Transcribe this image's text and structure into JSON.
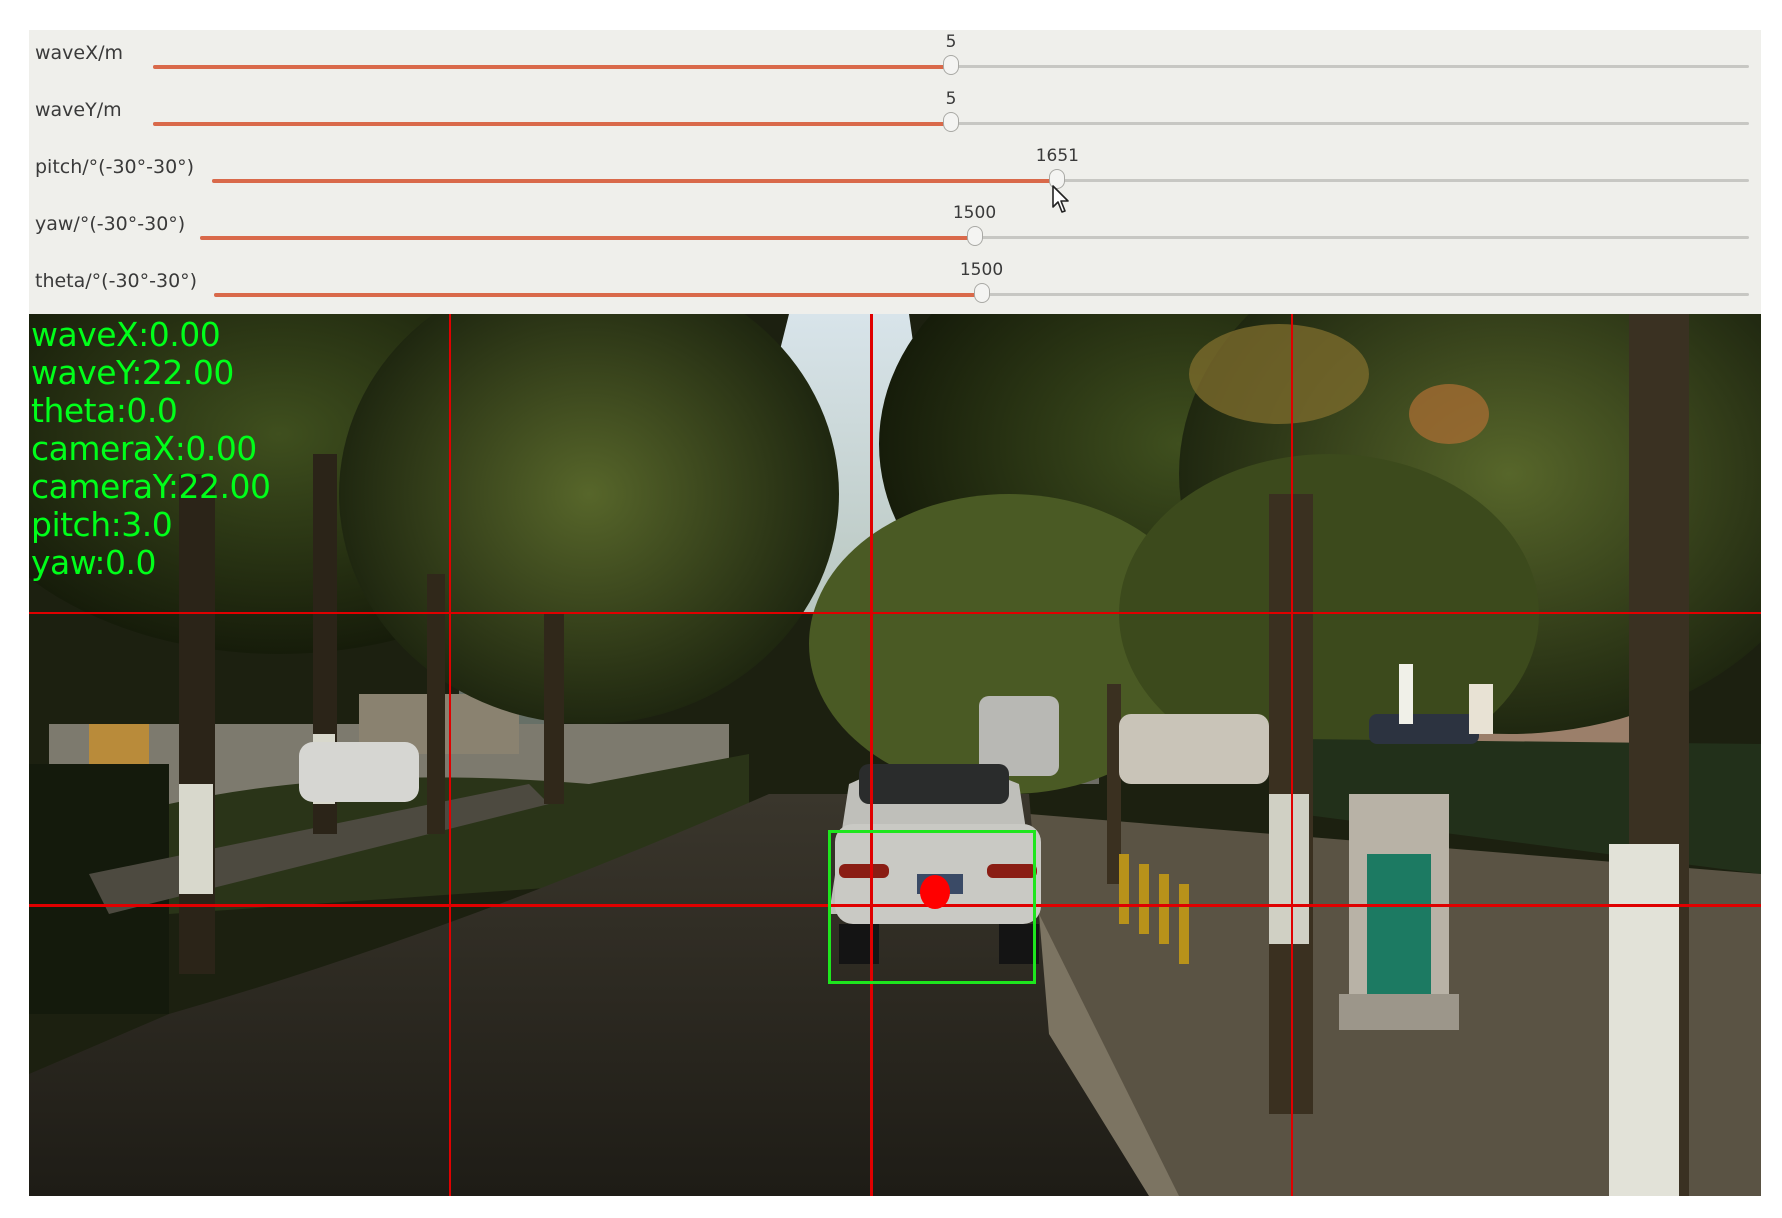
{
  "sliders": [
    {
      "label": "waveX/m",
      "value": "5",
      "fraction": 0.5
    },
    {
      "label": "waveY/m",
      "value": "5",
      "fraction": 0.5
    },
    {
      "label": "pitch/°(-30°-30°)",
      "value": "1651",
      "fraction": 0.55
    },
    {
      "label": "yaw/°(-30°-30°)",
      "value": "1500",
      "fraction": 0.5
    },
    {
      "label": "theta/°(-30°-30°)",
      "value": "1500",
      "fraction": 0.5
    }
  ],
  "overlay": {
    "lines": [
      "waveX:0.00",
      "waveY:22.00",
      "theta:0.0",
      "cameraX:0.00",
      "cameraY:22.00",
      "pitch:3.0",
      "yaw:0.0"
    ]
  },
  "colors": {
    "overlay_text": "#00ff1a",
    "grid": "#e00000",
    "bbox": "#1ee61e",
    "target_point": "#ff0000",
    "slider_fill": "#d9694a"
  },
  "icons": {
    "cursor": "mouse-pointer-icon"
  }
}
